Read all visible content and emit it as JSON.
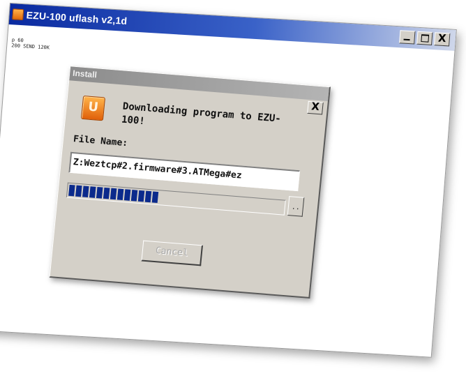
{
  "window": {
    "title": "EZU-100 uflash v2,1d",
    "icon": "app-icon",
    "controls": {
      "minimize": "minimize-icon",
      "maximize": "maximize-icon",
      "close_label": "X"
    }
  },
  "log": {
    "lines": [
      "p 60",
      "200 SEND 120K"
    ]
  },
  "dialog": {
    "title": "Install",
    "close_label": "X",
    "icon": "installer-icon",
    "message": "Downloading program to EZU-100!",
    "file_label": "File Name:",
    "file_value": "Z:Weztcp#2.firmware#3.ATMega#ez",
    "browse_label": "..",
    "progress": {
      "filled_segments": 13,
      "fraction": 0.5
    },
    "cancel_label": "Cancel",
    "cancel_enabled": false
  },
  "colors": {
    "titlebar_start": "#0a2aa0",
    "progress_fill": "#0b2a8c",
    "dialog_bg": "#d4d0c8"
  }
}
